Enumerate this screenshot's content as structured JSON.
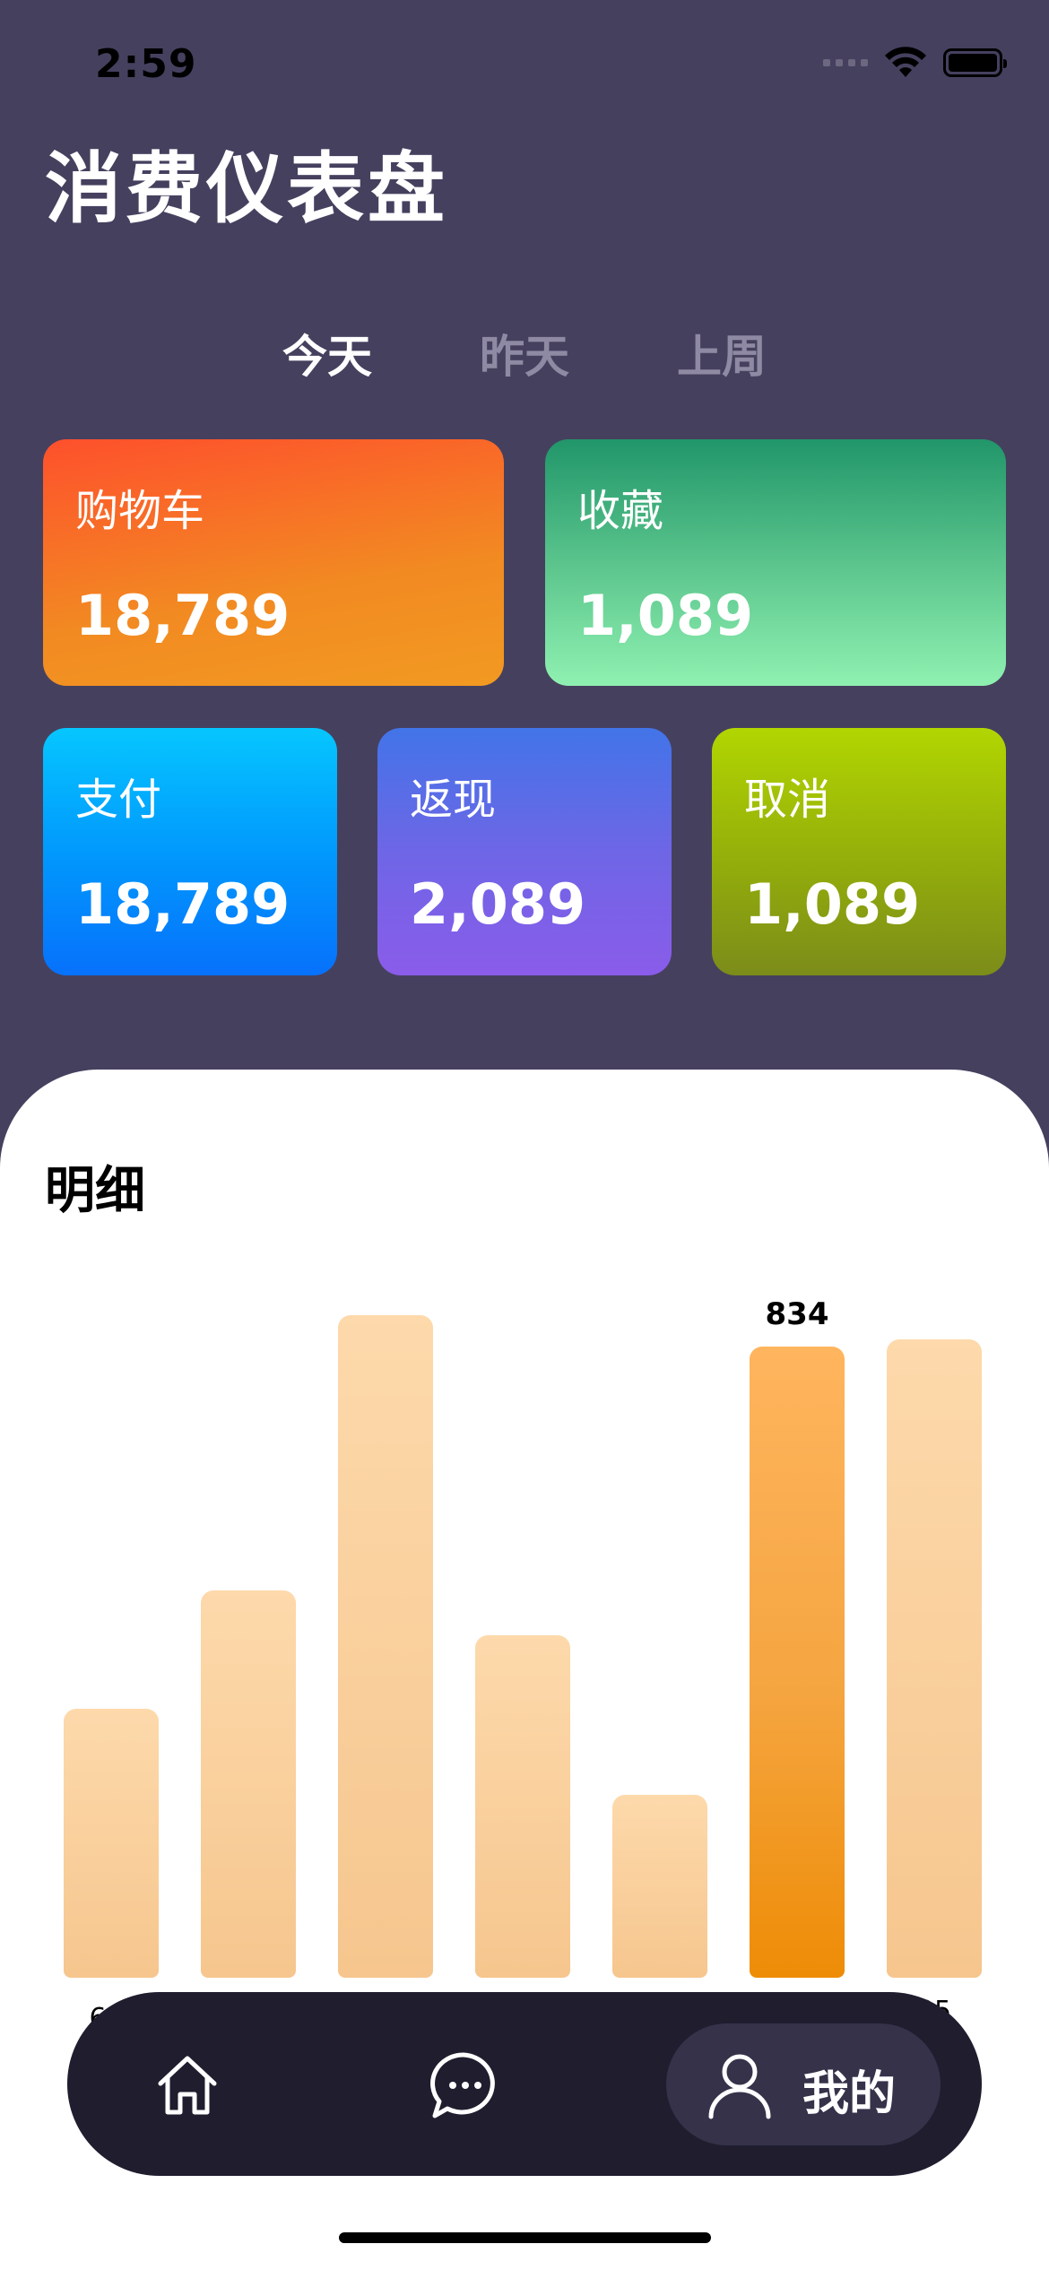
{
  "status_bar": {
    "time": "2:59"
  },
  "page_title": "消费仪表盘",
  "tabs": [
    {
      "label": "今天",
      "active": true
    },
    {
      "label": "昨天",
      "active": false
    },
    {
      "label": "上周",
      "active": false
    }
  ],
  "cards": {
    "cart": {
      "label": "购物车",
      "value": "18,789"
    },
    "fav": {
      "label": "收藏",
      "value": "1,089"
    },
    "pay": {
      "label": "支付",
      "value": "18,789"
    },
    "cash": {
      "label": "返现",
      "value": "2,089"
    },
    "cancel": {
      "label": "取消",
      "value": "1,089"
    }
  },
  "detail": {
    "title": "明细"
  },
  "chart_data": {
    "type": "bar",
    "categories": [
      "6月",
      "",
      "",
      "",
      "",
      "",
      "05"
    ],
    "values": [
      355,
      512,
      875,
      452,
      242,
      834,
      843
    ],
    "highlighted_index": 5,
    "highlighted_label": "834",
    "ylim": [
      0,
      900
    ],
    "grid": false,
    "colors": {
      "normal": "#f8cd97",
      "highlight": "#f5a540"
    }
  },
  "tabbar": {
    "me_label": "我的"
  }
}
